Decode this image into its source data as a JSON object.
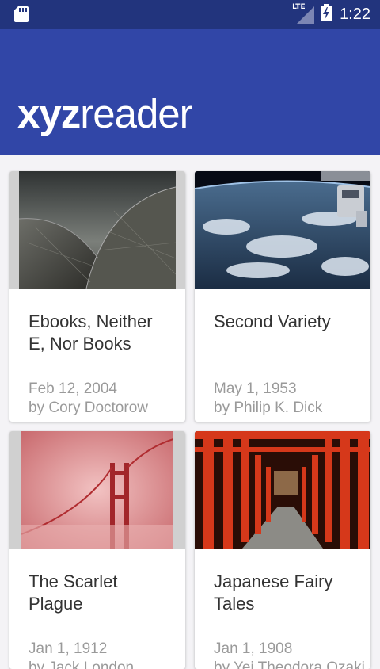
{
  "status_bar": {
    "network": "LTE",
    "time": "1:22",
    "icons": [
      "sd-card-icon",
      "signal-icon",
      "battery-charging-icon"
    ]
  },
  "app": {
    "logo_bold": "xyz",
    "logo_light": "reader",
    "colors": {
      "status_bar": "#22347d",
      "app_bar": "#3146a7"
    }
  },
  "articles": [
    {
      "title": "Ebooks, Neither E, Nor Books",
      "date": "Feb 12, 2004",
      "author": "by Cory Doctorow"
    },
    {
      "title": "Second Variety",
      "date": "May 1, 1953",
      "author": "by Philip K. Dick"
    },
    {
      "title": "The Scarlet Plague",
      "date": "Jan 1, 1912",
      "author": "by Jack London"
    },
    {
      "title": "Japanese Fairy Tales",
      "date": "Jan 1, 1908",
      "author": "by Yei Theodora Ozaki"
    }
  ]
}
